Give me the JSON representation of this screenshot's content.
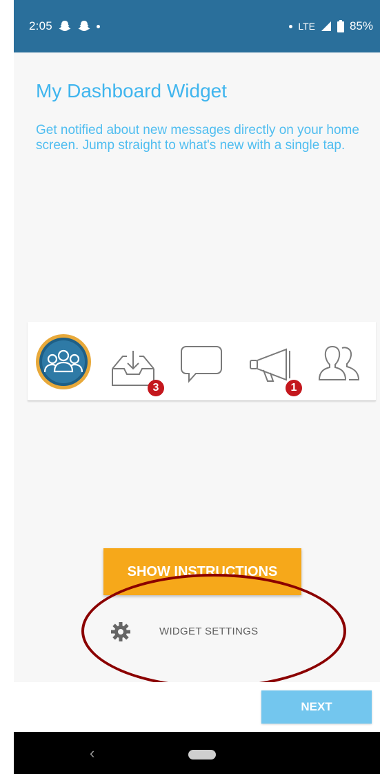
{
  "status_bar": {
    "time": "2:05",
    "network": "LTE",
    "battery": "85%"
  },
  "page": {
    "title": "My Dashboard Widget",
    "description": "Get notified about new messages directly on your home screen. Jump straight to what's new with a single tap."
  },
  "widget_preview": {
    "items": [
      {
        "icon": "groups-icon",
        "badge": ""
      },
      {
        "icon": "inbox-download-icon",
        "badge": "3"
      },
      {
        "icon": "chat-bubble-icon",
        "badge": ""
      },
      {
        "icon": "megaphone-icon",
        "badge": "1"
      },
      {
        "icon": "people-icon",
        "badge": ""
      }
    ]
  },
  "actions": {
    "show_instructions_label": "SHOW INSTRUCTIONS",
    "widget_settings_label": "WIDGET SETTINGS",
    "next_label": "NEXT"
  },
  "colors": {
    "status_bar": "#2a6f9b",
    "title_text": "#3fb5ee",
    "primary_button": "#f6a81a",
    "next_button": "#73c6ee",
    "badge": "#c4171d",
    "annotation_ring": "#8b0000"
  }
}
